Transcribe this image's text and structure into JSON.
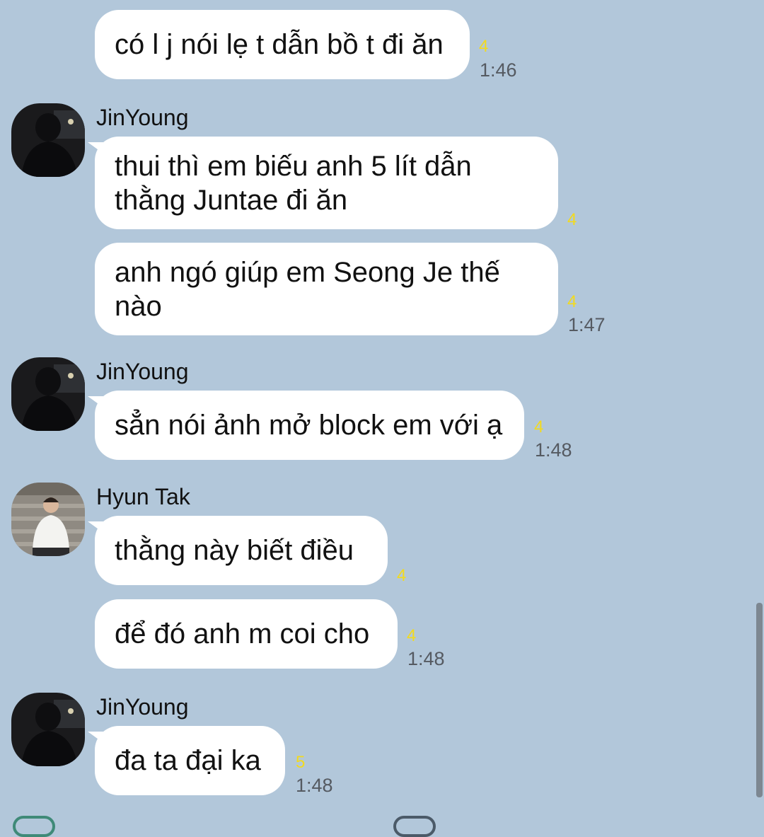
{
  "theme": {
    "background": "#b2c7da",
    "bubble": "#ffffff",
    "unread_color": "#f2da1f",
    "time_color": "#555a61"
  },
  "messages": [
    {
      "sender": "",
      "text": "có l j nói lẹ t dẫn bồ t đi ăn",
      "unread": "4",
      "time": "1:46"
    },
    {
      "sender": "JinYoung",
      "text": "thui thì em biếu anh 5 lít dẫn thằng Juntae đi ăn",
      "unread": "4",
      "time": ""
    },
    {
      "sender": "",
      "text": "anh ngó giúp em Seong Je thế nào",
      "unread": "4",
      "time": "1:47"
    },
    {
      "sender": "JinYoung",
      "text": "sẳn nói ảnh mở block em với ạ",
      "unread": "4",
      "time": "1:48"
    },
    {
      "sender": "Hyun Tak",
      "text": "thằng này biết điều",
      "unread": "4",
      "time": ""
    },
    {
      "sender": "",
      "text": "để đó anh m coi cho",
      "unread": "4",
      "time": "1:48"
    },
    {
      "sender": "JinYoung",
      "text": "đa ta đại ka",
      "unread": "5",
      "time": "1:48"
    }
  ]
}
